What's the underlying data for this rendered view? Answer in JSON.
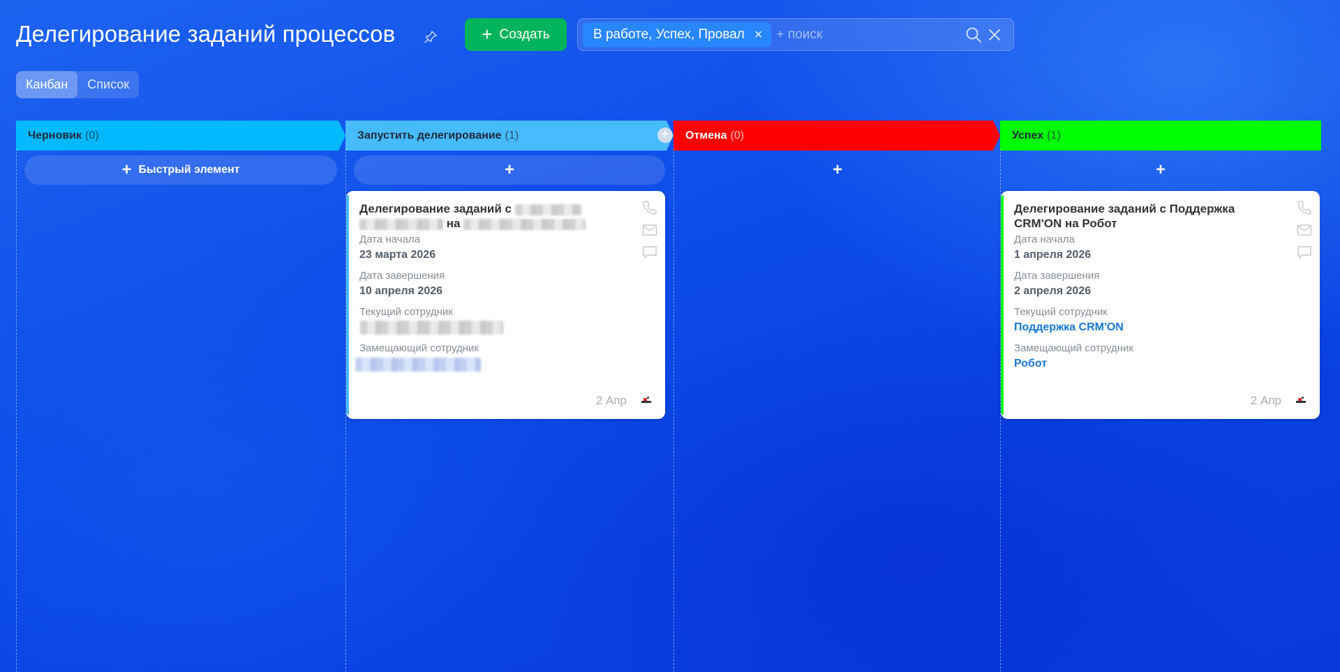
{
  "header": {
    "title": "Делегирование заданий процессов",
    "create_label": "Создать",
    "filter_chip": "В работе, Успех, Провал",
    "search_placeholder": "+ поиск"
  },
  "view_tabs": [
    {
      "label": "Канбан",
      "active": true
    },
    {
      "label": "Список",
      "active": false
    }
  ],
  "columns": [
    {
      "title": "Черновик",
      "count": "(0)",
      "color": "#00b9ff",
      "text_color": "#1e2a3a",
      "quick_add_label": "Быстрый элемент"
    },
    {
      "title": "Запустить делегирование",
      "count": "(1)",
      "color": "#47bbff",
      "text_color": "#1e2a3a"
    },
    {
      "title": "Отмена",
      "count": "(0)",
      "color": "#ff0000",
      "text_color": "#ffffff"
    },
    {
      "title": "Успех",
      "count": "(1)",
      "color": "#00ff00",
      "text_color": "#1e2a3a"
    }
  ],
  "cards": [
    {
      "title_prefix": "Делегирование заданий с",
      "title_mid": "на",
      "start_label": "Дата начала",
      "start_value": "23 марта 2026",
      "end_label": "Дата завершения",
      "end_value": "10 апреля 2026",
      "current_label": "Текущий сотрудник",
      "replacing_label": "Замещающий сотрудник",
      "date": "2 Апр",
      "accent": "#47bbff"
    },
    {
      "title": "Делегирование заданий с Поддержка CRM'ON на Робот",
      "start_label": "Дата начала",
      "start_value": "1 апреля 2026",
      "end_label": "Дата завершения",
      "end_value": "2 апреля 2026",
      "current_label": "Текущий сотрудник",
      "current_value": "Поддержка CRM'ON",
      "replacing_label": "Замещающий сотрудник",
      "replacing_value": "Робот",
      "date": "2 Апр",
      "accent": "#00ff00"
    }
  ]
}
